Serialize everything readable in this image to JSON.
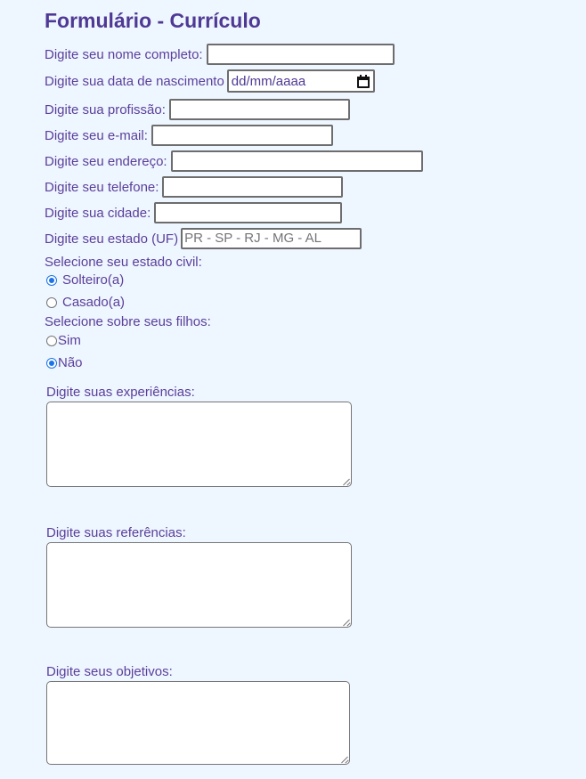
{
  "form": {
    "title": "Formulário - Currículo",
    "fields": {
      "nome": {
        "label": "Digite seu nome completo:",
        "value": ""
      },
      "nascimento": {
        "label": "Digite sua data de nascimento",
        "placeholder": "dd/mm/aaaa"
      },
      "profissao": {
        "label": "Digite sua profissão:",
        "value": ""
      },
      "email": {
        "label": "Digite seu e-mail:",
        "value": ""
      },
      "endereco": {
        "label": "Digite seu endereço:",
        "value": ""
      },
      "telefone": {
        "label": "Digite seu telefone:",
        "value": ""
      },
      "cidade": {
        "label": "Digite sua cidade:",
        "value": ""
      },
      "estado": {
        "label": "Digite seu estado (UF)",
        "placeholder": "PR - SP - RJ - MG - AL"
      }
    },
    "estado_civil": {
      "label": "Selecione seu estado civil:",
      "options": [
        "Solteiro(a)",
        "Casado(a)"
      ],
      "selected": "Solteiro(a)"
    },
    "filhos": {
      "label": "Selecione sobre seus filhos:",
      "options": [
        "Sim",
        "Não"
      ],
      "selected": "Não"
    },
    "experiencias": {
      "label": "Digite suas experiências:",
      "value": ""
    },
    "referencias": {
      "label": "Digite suas referências:",
      "value": ""
    },
    "objetivos": {
      "label": "Digite seus objetivos:",
      "value": ""
    }
  }
}
